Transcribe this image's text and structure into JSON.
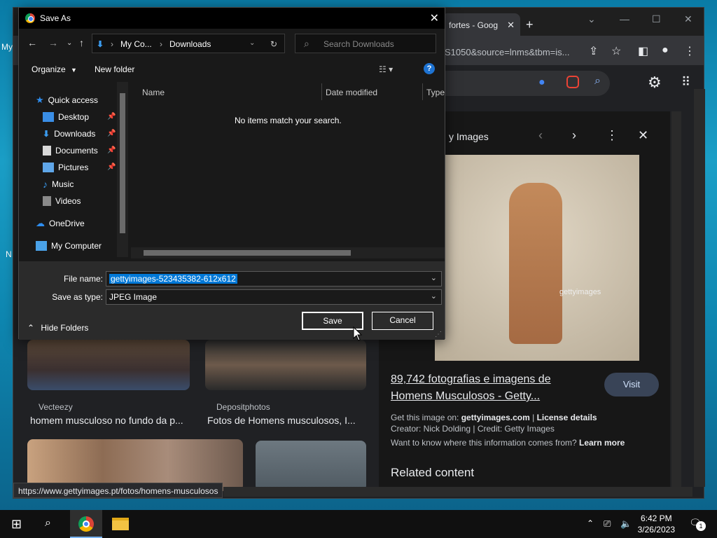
{
  "desktop": {
    "labels": [
      "My",
      "N"
    ]
  },
  "browser": {
    "tab_title": "fortes - Goog",
    "url": "S1050&source=lnms&tbm=is...",
    "status_url": "https://www.gettyimages.pt/fotos/homens-musculosos",
    "results": [
      {
        "source": "Vecteezy",
        "title": "homem musculoso no fundo da p..."
      },
      {
        "source": "Depositphotos",
        "title": "Fotos de Homens musculosos, I..."
      }
    ],
    "panel": {
      "source_label": "y Images",
      "title_line1": "89,742 fotografias e imagens de",
      "title_line2": "Homens Musculosos - Getty...",
      "visit": "Visit",
      "get_prefix": "Get this image on: ",
      "get_site": "gettyimages.com",
      "sep": " | ",
      "license": "License details",
      "creator": "Creator: Nick Dolding | Credit: Getty Images",
      "want": "Want to know where this information comes from? ",
      "learn": "Learn more",
      "related": "Related content",
      "watermark": "gettyimages"
    }
  },
  "dialog": {
    "title": "Save As",
    "breadcrumb": [
      "My Co...",
      "Downloads"
    ],
    "search_placeholder": "Search Downloads",
    "organize": "Organize",
    "new_folder": "New folder",
    "nav": [
      {
        "label": "Quick access",
        "icon": "star-icon"
      },
      {
        "label": "Desktop",
        "icon": "desktop-folder-icon",
        "pinned": true
      },
      {
        "label": "Downloads",
        "icon": "download-arrow-icon",
        "pinned": true
      },
      {
        "label": "Documents",
        "icon": "documents-icon",
        "pinned": true
      },
      {
        "label": "Pictures",
        "icon": "pictures-icon",
        "pinned": true
      },
      {
        "label": "Music",
        "icon": "music-note-icon"
      },
      {
        "label": "Videos",
        "icon": "videos-icon"
      },
      {
        "label": "OneDrive",
        "icon": "cloud-icon"
      },
      {
        "label": "My Computer",
        "icon": "computer-icon"
      }
    ],
    "columns": [
      "Name",
      "Date modified",
      "Type"
    ],
    "empty_message": "No items match your search.",
    "file_name_label": "File name:",
    "file_name_value": "gettyimages-523435382-612x612",
    "save_type_label": "Save as type:",
    "save_type_value": "JPEG Image",
    "hide_folders": "Hide Folders",
    "save": "Save",
    "cancel": "Cancel"
  },
  "taskbar": {
    "time": "6:42 PM",
    "date": "3/26/2023",
    "notif_count": "1"
  }
}
